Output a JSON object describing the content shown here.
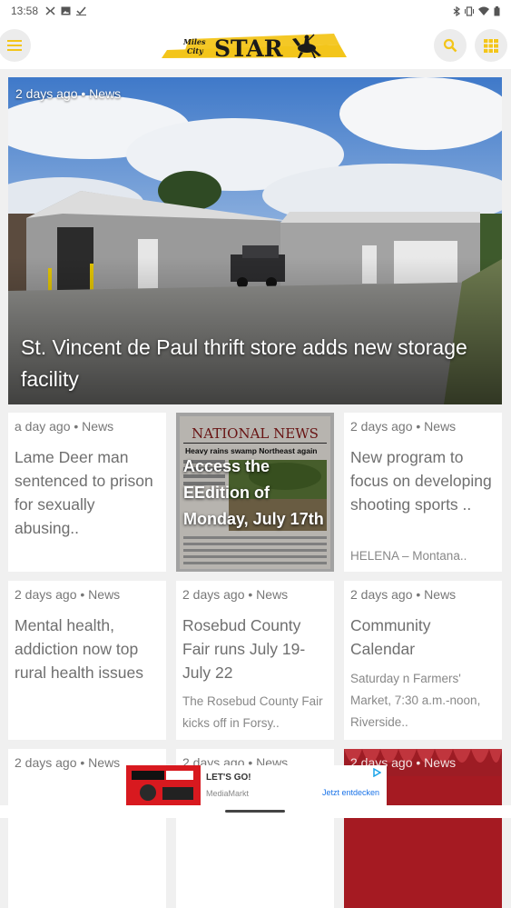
{
  "status_bar": {
    "time": "13:58"
  },
  "app": {
    "logo_text_top": "Miles",
    "logo_text_bottom": "City",
    "logo_text_main": "STAR"
  },
  "colors": {
    "accent": "#f3c51a",
    "background": "#f0f0f0"
  },
  "hero": {
    "meta": "2 days ago • News",
    "title": "St. Vincent de Paul thrift store adds new storage facility"
  },
  "cards": [
    {
      "meta": "a day ago • News",
      "title": "Lame Deer man sentenced to prison for sexually abusing..",
      "excerpt": ""
    },
    {
      "meta": "",
      "title": "Access the EEdition of Monday, July 17th",
      "excerpt": "",
      "newspaper_name": "NATIONAL NEWS",
      "newspaper_headline": "Heavy rains swamp Northeast again"
    },
    {
      "meta": "2 days ago • News",
      "title": "New program to focus on developing shooting sports ..",
      "excerpt": "HELENA – Montana.."
    },
    {
      "meta": "2 days ago • News",
      "title": "Mental health, addiction now top rural health issues",
      "excerpt": ""
    },
    {
      "meta": "2 days ago • News",
      "title": "Rosebud County Fair runs July 19-July 22",
      "excerpt": "The Rosebud County Fair kicks off in Forsy.."
    },
    {
      "meta": "2 days ago • News",
      "title": "Community Calendar",
      "excerpt": "Saturday n Farmers' Market, 7:30 a.m.-noon, Riverside.."
    },
    {
      "meta": "2 days ago • News"
    },
    {
      "meta": "2 days ago • News"
    },
    {
      "meta": "2 days ago • News"
    }
  ],
  "ad": {
    "headline": "LET'S GO!",
    "brand": "MediaMarkt",
    "cta": "Jetzt entdecken"
  },
  "icons": [
    "signal-icon",
    "image-icon",
    "check-icon",
    "bluetooth-icon",
    "vibrate-icon",
    "wifi-icon",
    "battery-icon",
    "menu-icon",
    "search-icon",
    "grid-icon",
    "ad-choices-icon"
  ]
}
